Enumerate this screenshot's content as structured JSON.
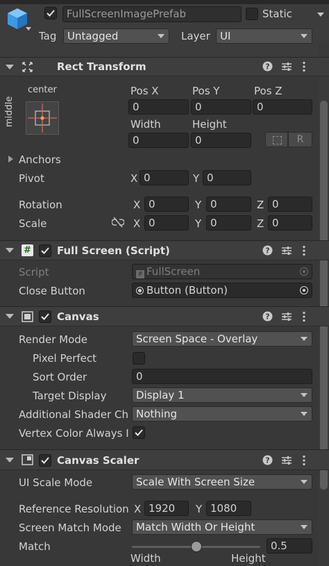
{
  "object": {
    "active": true,
    "name": "FullScreenImagePrefab",
    "static_label": "Static",
    "tag_label": "Tag",
    "tag_value": "Untagged",
    "layer_label": "Layer",
    "layer_value": "UI"
  },
  "rect_transform": {
    "title": "Rect Transform",
    "anchor_h": "center",
    "anchor_v": "middle",
    "pos_x_label": "Pos X",
    "pos_y_label": "Pos Y",
    "pos_z_label": "Pos Z",
    "pos_x": "0",
    "pos_y": "0",
    "pos_z": "0",
    "width_label": "Width",
    "height_label": "Height",
    "width": "0",
    "height": "0",
    "r_label": "R",
    "anchors_label": "Anchors",
    "pivot_label": "Pivot",
    "pivot_x": "0",
    "pivot_y": "0",
    "rotation_label": "Rotation",
    "rot_x": "0",
    "rot_y": "0",
    "rot_z": "0",
    "scale_label": "Scale",
    "scale_x": "0",
    "scale_y": "0",
    "scale_z": "0",
    "x": "X",
    "y": "Y",
    "z": "Z"
  },
  "full_screen": {
    "title": "Full Screen (Script)",
    "enabled": true,
    "script_label": "Script",
    "script_value": "FullScreen",
    "close_label": "Close Button",
    "close_value": "Button (Button)"
  },
  "canvas": {
    "title": "Canvas",
    "enabled": true,
    "render_mode_label": "Render Mode",
    "render_mode": "Screen Space - Overlay",
    "pixel_perfect_label": "Pixel Perfect",
    "pixel_perfect": false,
    "sort_order_label": "Sort Order",
    "sort_order": "0",
    "target_display_label": "Target Display",
    "target_display": "Display 1",
    "shader_label": "Additional Shader Ch",
    "shader_value": "Nothing",
    "vertex_label": "Vertex Color Always I",
    "vertex_value": true
  },
  "canvas_scaler": {
    "title": "Canvas Scaler",
    "enabled": true,
    "ui_scale_label": "UI Scale Mode",
    "ui_scale": "Scale With Screen Size",
    "ref_label": "Reference Resolution",
    "ref_x": "1920",
    "ref_y": "1080",
    "match_mode_label": "Screen Match Mode",
    "match_mode": "Match Width Or Height",
    "match_label": "Match",
    "match_value": "0.5",
    "match_fraction": 0.5,
    "width_label": "Width",
    "height_label": "Height"
  },
  "icons": [
    "prefab-cube-icon",
    "help-icon",
    "preset-icon",
    "kebab-menu-icon",
    "rect-transform-icon",
    "script-hash-icon",
    "canvas-icon",
    "canvas-scaler-icon",
    "unlink-icon",
    "object-picker-icon"
  ]
}
